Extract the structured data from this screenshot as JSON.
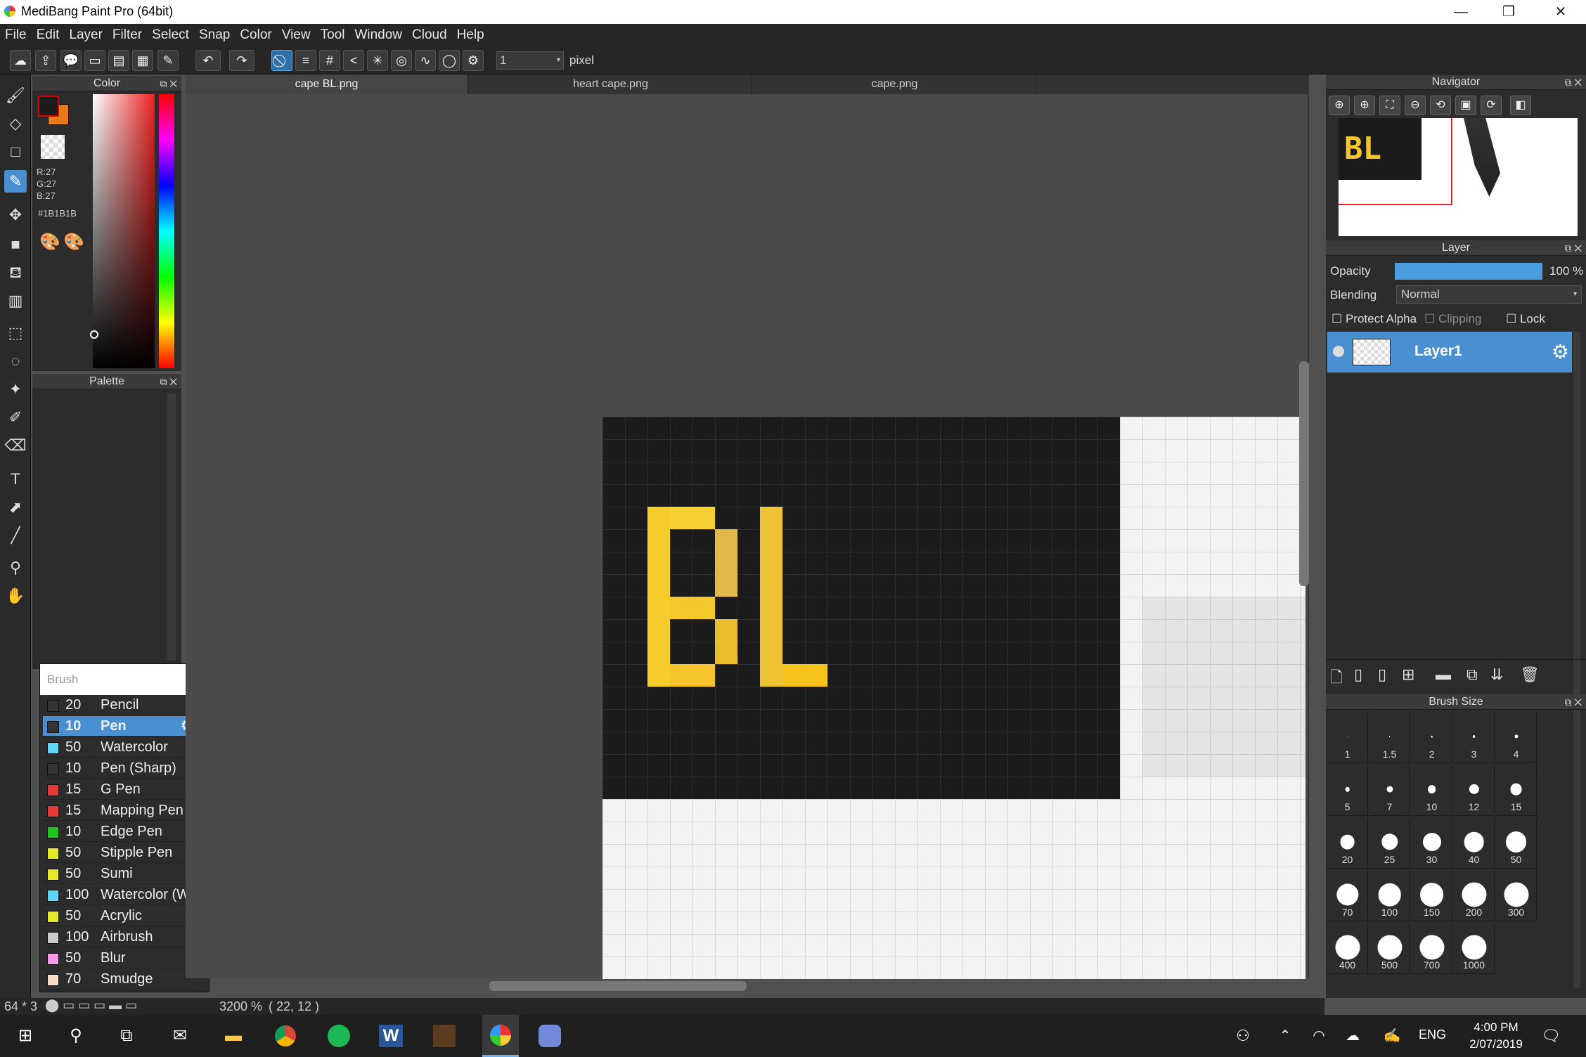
{
  "app": {
    "title": "MediBang Paint Pro (64bit)",
    "min": "—",
    "restore": "❐",
    "close": "✕"
  },
  "menu": [
    "File",
    "Edit",
    "Layer",
    "Filter",
    "Select",
    "Snap",
    "Color",
    "View",
    "Tool",
    "Window",
    "Cloud",
    "Help"
  ],
  "toolbar": {
    "brush_size_value": "1",
    "unit": "pixel"
  },
  "tabs": [
    {
      "label": "cape BL.png",
      "active": true
    },
    {
      "label": "heart cape.png",
      "active": false
    },
    {
      "label": "cape.png",
      "active": false
    }
  ],
  "color_panel": {
    "title": "Color",
    "r": "R:27",
    "g": "G:27",
    "b": "B:27",
    "hex": "#1B1B1B",
    "fg": "#1b1b1b",
    "bg": "#e87a1a"
  },
  "palette_panel": {
    "title": "Palette"
  },
  "brush_panel": {
    "title": "Brush",
    "items": [
      {
        "size": "20",
        "name": "Pencil",
        "color": "#333333"
      },
      {
        "size": "10",
        "name": "Pen",
        "color": "#333333",
        "selected": true
      },
      {
        "size": "50",
        "name": "Watercolor",
        "color": "#5fd6f5"
      },
      {
        "size": "10",
        "name": "Pen (Sharp)",
        "color": "#333333"
      },
      {
        "size": "15",
        "name": "G Pen",
        "color": "#e33a3a"
      },
      {
        "size": "15",
        "name": "Mapping Pen",
        "color": "#e33a3a"
      },
      {
        "size": "10",
        "name": "Edge Pen",
        "color": "#22c322"
      },
      {
        "size": "50",
        "name": "Stipple Pen",
        "color": "#e8e82a"
      },
      {
        "size": "50",
        "name": "Sumi",
        "color": "#e8e82a"
      },
      {
        "size": "100",
        "name": "Watercolor (We",
        "color": "#5fd6f5"
      },
      {
        "size": "50",
        "name": "Acrylic",
        "color": "#e8e82a"
      },
      {
        "size": "100",
        "name": "Airbrush",
        "color": "#cccccc"
      },
      {
        "size": "50",
        "name": "Blur",
        "color": "#f59ae8"
      },
      {
        "size": "70",
        "name": "Smudge",
        "color": "#f7dcc8"
      }
    ]
  },
  "status": {
    "doc_size": "64 * 3",
    "zoom": "3200 %",
    "coords": "( 22, 12 )"
  },
  "navigator": {
    "title": "Navigator"
  },
  "layer_panel": {
    "title": "Layer",
    "opacity_label": "Opacity",
    "opacity_value": "100 %",
    "blending_label": "Blending",
    "blending_value": "Normal",
    "protect_alpha": "Protect Alpha",
    "clipping": "Clipping",
    "lock": "Lock",
    "layers": [
      {
        "name": "Layer1",
        "selected": true
      }
    ]
  },
  "brush_size_panel": {
    "title": "Brush Size",
    "sizes": [
      "1",
      "1.5",
      "2",
      "3",
      "4",
      "5",
      "7",
      "10",
      "12",
      "15",
      "20",
      "25",
      "30",
      "40",
      "50",
      "70",
      "100",
      "150",
      "200",
      "300",
      "400",
      "500",
      "700",
      "1000"
    ]
  },
  "taskbar": {
    "lang": "ENG",
    "time": "4:00 PM",
    "date": "2/07/2019"
  }
}
